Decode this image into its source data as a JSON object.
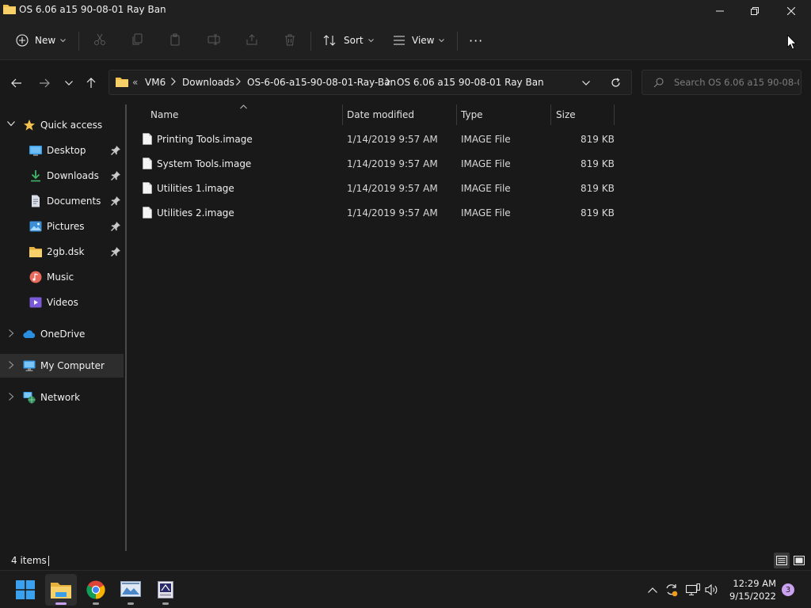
{
  "window": {
    "title": "OS 6.06 a15 90-08-01 Ray Ban"
  },
  "toolbar": {
    "new_label": "New",
    "sort_label": "Sort",
    "view_label": "View",
    "more_label": "···"
  },
  "address": {
    "overflow": "«",
    "crumbs": [
      "VM6",
      "Downloads",
      "OS-6-06-a15-90-08-01-Ray-Ban",
      "OS 6.06 a15 90-08-01 Ray Ban"
    ]
  },
  "search": {
    "placeholder": "Search OS 6.06 a15 90-08-01 ..."
  },
  "sidebar": {
    "quick_access": "Quick access",
    "items": [
      {
        "label": "Desktop",
        "icon": "desktop-icon",
        "pinned": true
      },
      {
        "label": "Downloads",
        "icon": "download-icon",
        "pinned": true
      },
      {
        "label": "Documents",
        "icon": "document-icon",
        "pinned": true
      },
      {
        "label": "Pictures",
        "icon": "picture-icon",
        "pinned": true
      },
      {
        "label": "2gb.dsk",
        "icon": "folder-icon",
        "pinned": true
      },
      {
        "label": "Music",
        "icon": "music-icon",
        "pinned": false
      },
      {
        "label": "Videos",
        "icon": "video-icon",
        "pinned": false
      }
    ],
    "onedrive": "OneDrive",
    "my_computer": "My Computer",
    "network": "Network"
  },
  "columns": {
    "name": "Name",
    "date": "Date modified",
    "type": "Type",
    "size": "Size"
  },
  "files": [
    {
      "name": "Printing Tools.image",
      "date": "1/14/2019 9:57 AM",
      "type": "IMAGE File",
      "size": "819 KB"
    },
    {
      "name": "System Tools.image",
      "date": "1/14/2019 9:57 AM",
      "type": "IMAGE File",
      "size": "819 KB"
    },
    {
      "name": "Utilities 1.image",
      "date": "1/14/2019 9:57 AM",
      "type": "IMAGE File",
      "size": "819 KB"
    },
    {
      "name": "Utilities 2.image",
      "date": "1/14/2019 9:57 AM",
      "type": "IMAGE File",
      "size": "819 KB"
    }
  ],
  "status": {
    "item_count": "4 items"
  },
  "taskbar": {
    "time": "12:29 AM",
    "date": "9/15/2022",
    "notification_count": "3"
  },
  "colors": {
    "folder": "#f2c14e",
    "accent": "#c9a1f0",
    "star": "#f2c14e"
  }
}
